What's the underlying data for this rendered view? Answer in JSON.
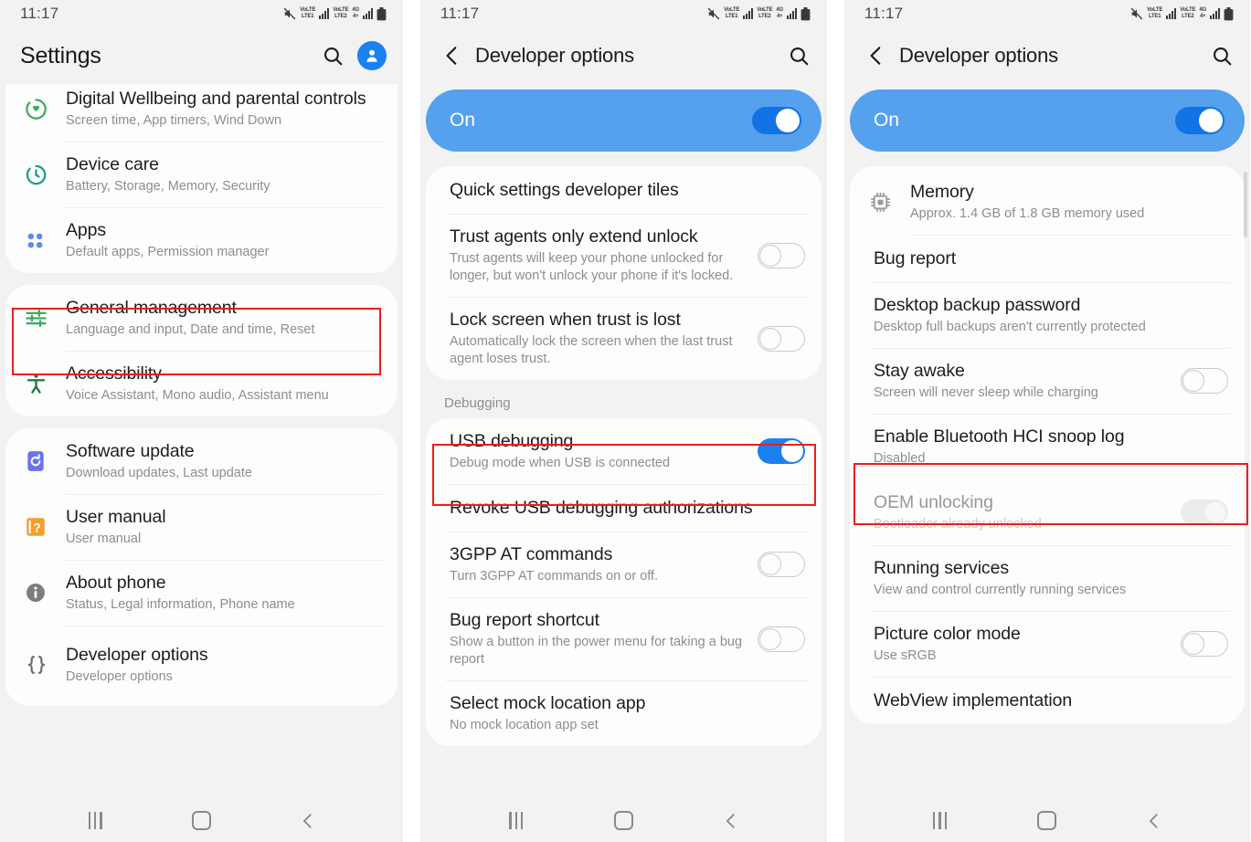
{
  "statusbar": {
    "time": "11:17",
    "icons": [
      "mute-icon",
      "volte-sim1-icon",
      "signal-sim1-icon",
      "volte-sim2-icon",
      "4g-icon",
      "signal-sim2-icon",
      "battery-icon"
    ],
    "volte_top": "VoLTE",
    "volte_bottom": "LTE1",
    "volte2_top": "VoLTE",
    "volte2_bottom": "LTE2",
    "net_top": "4G",
    "net_bottom": "4+"
  },
  "colors": {
    "accent_blue": "#1a81f0",
    "banner_blue": "#55a1ee",
    "highlight_red": "#ee1d1d",
    "page_bg": "#f2f2f2",
    "card_bg": "#fdfdfd",
    "primary_text": "#1d1d1d",
    "secondary_text": "#8e8e8e",
    "green_icon": "#3bab5e",
    "teal_icon": "#17a08a",
    "blue_icon": "#5b8dea",
    "purple_icon": "#6b73e8",
    "orange_icon": "#f0a030",
    "grey_icon": "#7d7d7d"
  },
  "panel1": {
    "header": {
      "title": "Settings",
      "search_icon": "search-icon",
      "account_icon": "account-avatar-icon"
    },
    "groups": [
      {
        "id": "group-a",
        "items": [
          {
            "icon": "digital-wellbeing-icon",
            "icon_kind": "wellbeing",
            "title": "Digital Wellbeing and parental controls",
            "subtitle": "Screen time, App timers, Wind Down"
          },
          {
            "icon": "device-care-icon",
            "icon_kind": "devicecare",
            "title": "Device care",
            "subtitle": "Battery, Storage, Memory, Security"
          },
          {
            "icon": "apps-icon",
            "icon_kind": "apps",
            "title": "Apps",
            "subtitle": "Default apps, Permission manager"
          }
        ]
      },
      {
        "id": "group-b",
        "items": [
          {
            "icon": "sliders-icon",
            "icon_kind": "sliders",
            "title": "General management",
            "subtitle": "Language and input, Date and time, Reset"
          },
          {
            "icon": "accessibility-icon",
            "icon_kind": "accessibility",
            "title": "Accessibility",
            "subtitle": "Voice Assistant, Mono audio, Assistant menu"
          }
        ]
      },
      {
        "id": "group-c",
        "items": [
          {
            "icon": "software-update-icon",
            "icon_kind": "update",
            "title": "Software update",
            "subtitle": "Download updates, Last update"
          },
          {
            "icon": "user-manual-icon",
            "icon_kind": "manual",
            "title": "User manual",
            "subtitle": "User manual"
          },
          {
            "icon": "about-phone-icon",
            "icon_kind": "info",
            "title": "About phone",
            "subtitle": "Status, Legal information, Phone name"
          },
          {
            "icon": "developer-options-icon",
            "icon_kind": "braces",
            "title": "Developer options",
            "subtitle": "Developer options",
            "highlighted": true
          }
        ]
      }
    ]
  },
  "panel2": {
    "header": {
      "back_icon": "back-chevron-icon",
      "title": "Developer options",
      "search_icon": "search-icon"
    },
    "banner": {
      "label": "On",
      "state": "on"
    },
    "card1": [
      {
        "title": "Quick settings developer tiles",
        "subtitle": "",
        "toggle": "none"
      },
      {
        "title": "Trust agents only extend unlock",
        "subtitle": "Trust agents will keep your phone unlocked for longer, but won't unlock your phone if it's locked.",
        "toggle": "off"
      },
      {
        "title": "Lock screen when trust is lost",
        "subtitle": "Automatically lock the screen when the last trust agent loses trust.",
        "toggle": "off"
      }
    ],
    "group_header": "Debugging",
    "card2": [
      {
        "title": "USB debugging",
        "subtitle": "Debug mode when USB is connected",
        "toggle": "on",
        "highlighted": true
      },
      {
        "title": "Revoke USB debugging authorizations",
        "subtitle": "",
        "toggle": "none"
      },
      {
        "title": "3GPP AT commands",
        "subtitle": "Turn 3GPP AT commands on or off.",
        "toggle": "off"
      },
      {
        "title": "Bug report shortcut",
        "subtitle": "Show a button in the power menu for taking a bug report",
        "toggle": "off"
      },
      {
        "title": "Select mock location app",
        "subtitle": "No mock location app set",
        "toggle": "none"
      }
    ]
  },
  "panel3": {
    "header": {
      "back_icon": "back-chevron-icon",
      "title": "Developer options",
      "search_icon": "search-icon"
    },
    "banner": {
      "label": "On",
      "state": "on"
    },
    "items": [
      {
        "icon": "memory-chip-icon",
        "title": "Memory",
        "subtitle": "Approx. 1.4 GB of 1.8 GB memory used",
        "toggle": "none"
      },
      {
        "title": "Bug report",
        "subtitle": "",
        "toggle": "none"
      },
      {
        "title": "Desktop backup password",
        "subtitle": "Desktop full backups aren't currently protected",
        "toggle": "none"
      },
      {
        "title": "Stay awake",
        "subtitle": "Screen will never sleep while charging",
        "toggle": "off"
      },
      {
        "title": "Enable Bluetooth HCI snoop log",
        "subtitle": "Disabled",
        "toggle": "none"
      },
      {
        "title": "OEM unlocking",
        "subtitle": "Bootloader already unlocked",
        "toggle": "disabled",
        "highlighted": true,
        "dimmed": true
      },
      {
        "title": "Running services",
        "subtitle": "View and control currently running services",
        "toggle": "none"
      },
      {
        "title": "Picture color mode",
        "subtitle": "Use sRGB",
        "toggle": "off"
      },
      {
        "title": "WebView implementation",
        "subtitle": "",
        "toggle": "none"
      }
    ]
  },
  "navbar": {
    "recents_label": "recents-icon",
    "home_label": "home-icon",
    "back_label": "back-icon"
  }
}
